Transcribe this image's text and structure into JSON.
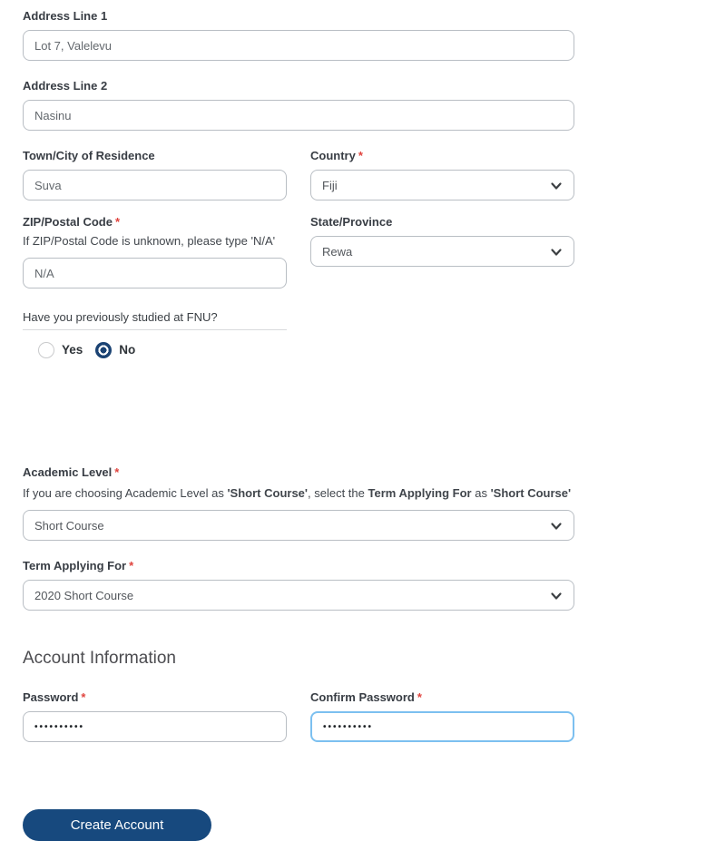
{
  "misc": {
    "required_marker": "*"
  },
  "colors": {
    "accent_navy": "#17497E",
    "focus_blue": "#7CC0F0",
    "required_red": "#E0443E"
  },
  "form": {
    "address1": {
      "label": "Address Line 1",
      "value": "Lot 7, Valelevu"
    },
    "address2": {
      "label": "Address Line 2",
      "value": "Nasinu"
    },
    "town": {
      "label": "Town/City of Residence",
      "value": "Suva"
    },
    "country": {
      "label": "Country",
      "value": "Fiji"
    },
    "zip": {
      "label": "ZIP/Postal Code",
      "helper": "If ZIP/Postal Code is unknown, please type 'N/A'",
      "value": "N/A"
    },
    "state": {
      "label": "State/Province",
      "value": "Rewa"
    },
    "fnu_question": {
      "label": "Have you previously studied at FNU?",
      "options": [
        {
          "label": "Yes",
          "selected": false
        },
        {
          "label": "No",
          "selected": true
        }
      ]
    },
    "academic_level": {
      "label": "Academic Level",
      "helper_parts": [
        "If you are choosing Academic Level as ",
        "'Short Course'",
        ", select the ",
        "Term Applying For",
        " as ",
        "'Short Course'"
      ],
      "value": "Short Course"
    },
    "term": {
      "label": "Term Applying For",
      "value": "2020 Short Course"
    }
  },
  "account": {
    "heading": "Account Information",
    "password": {
      "label": "Password",
      "value": "••••••••••"
    },
    "confirm": {
      "label": "Confirm Password",
      "value": "••••••••••"
    }
  },
  "button": {
    "label": "Create Account"
  }
}
